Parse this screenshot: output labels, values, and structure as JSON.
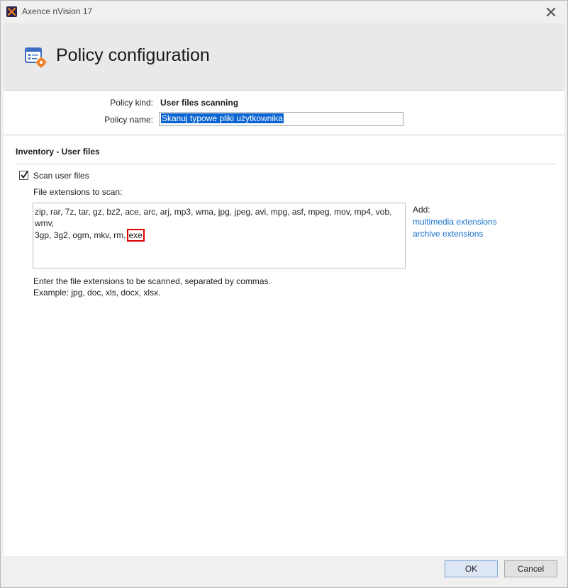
{
  "window": {
    "title": "Axence nVision 17"
  },
  "header": {
    "title": "Policy configuration"
  },
  "policy": {
    "kind_label": "Policy kind:",
    "kind_value": "User files scanning",
    "name_label": "Policy name:",
    "name_value": "Skanuj typowe pliki użytkownika"
  },
  "section": {
    "title": "Inventory - User files"
  },
  "scan": {
    "checkbox_label": "Scan user files",
    "checked": true,
    "extensions_label": "File extensions to scan:",
    "extensions_line1": "zip, rar, 7z, tar, gz, bz2, ace, arc, arj, mp3, wma, jpg, jpeg, avi, mpg, asf, mpeg, mov, mp4, vob, wmv,",
    "extensions_line2": "3gp, 3g2, ogm, mkv, rm,",
    "extensions_highlight": "exe"
  },
  "add": {
    "label": "Add:",
    "multimedia_link": "multimedia extensions",
    "archive_link": "archive extensions"
  },
  "hint": {
    "line1": "Enter the file extensions to be scanned, separated by commas.",
    "line2": "Example: jpg, doc, xls, docx, xlsx."
  },
  "buttons": {
    "ok": "OK",
    "cancel": "Cancel"
  },
  "colors": {
    "link": "#1470c8",
    "selection": "#0a64d2",
    "highlight_box": "#e00000"
  }
}
